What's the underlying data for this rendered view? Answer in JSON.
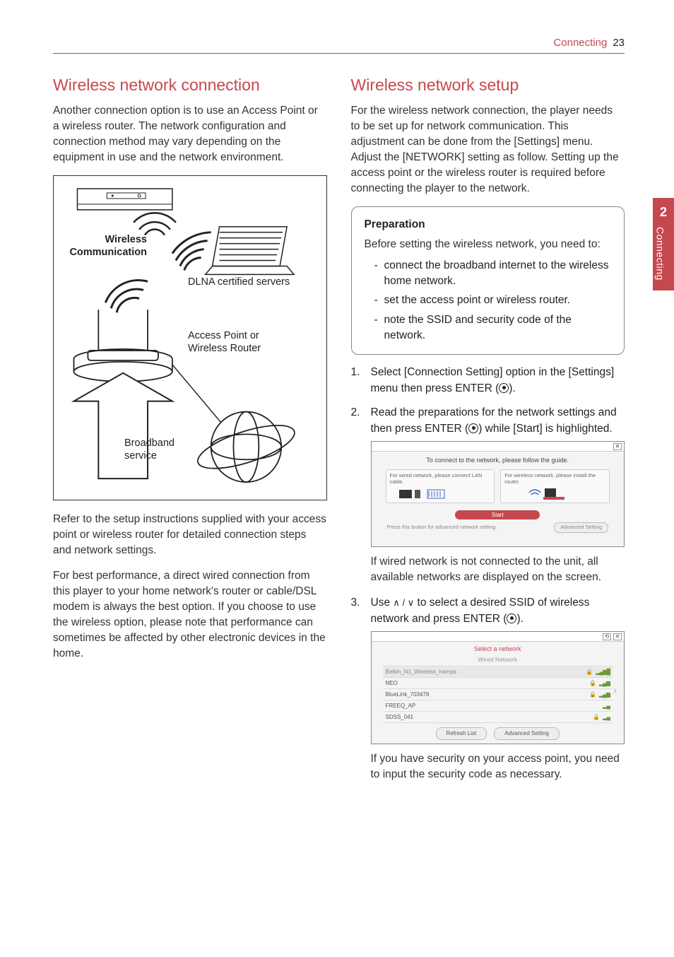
{
  "header": {
    "section": "Connecting",
    "page": "23"
  },
  "sidetab": {
    "number": "2",
    "label": "Connecting"
  },
  "left": {
    "heading": "Wireless network connection",
    "intro": "Another connection option is to use an Access Point or a wireless router. The network configuration and connection method may vary depending on the equipment in use and the network environment.",
    "diagram": {
      "wireless_comm_1": "Wireless",
      "wireless_comm_2": "Communication",
      "dlna": "DLNA certified servers",
      "ap_1": "Access Point or",
      "ap_2": "Wireless Router",
      "bb_1": "Broadband",
      "bb_2": "service"
    },
    "p2": "Refer to the setup instructions supplied with your access point or wireless router for detailed connection steps and network settings.",
    "p3": "For best performance, a direct wired connection from this player to your home network's router or cable/DSL modem is always the best option. If you choose to use the wireless option, please note that performance can sometimes be affected by other electronic devices in the home."
  },
  "right": {
    "heading": "Wireless network setup",
    "intro": "For the wireless network connection, the player needs to be set up for network communication. This adjustment can be done from the [Settings] menu. Adjust the [NETWORK] setting as follow. Setting up the access point or the wireless router is required before connecting the player to the network.",
    "prep": {
      "title": "Preparation",
      "lead": "Before setting the wireless network, you need to:",
      "items": [
        "connect the broadband internet to the wireless home network.",
        "set the access point or wireless router.",
        "note the SSID and security code of the network."
      ]
    },
    "steps": {
      "s1_num": "1.",
      "s1": "Select [Connection Setting] option in the [Settings] menu then press ENTER (",
      "s1_end": ").",
      "s2_num": "2.",
      "s2": "Read the preparations for the network settings and then press ENTER (",
      "s2_end": ") while [Start] is highlighted.",
      "s2_after": "If wired network is not connected to the unit, all available networks are displayed on the screen.",
      "s3_num": "3.",
      "s3_a": "Use ",
      "s3_arrows": "∧ / ∨",
      "s3_b": " to select a desired SSID of wireless network and press ENTER (",
      "s3_end": ").",
      "s3_after": "If you have security on your access point, you need to input the security code as necessary."
    },
    "screenshot1": {
      "guide": "To connect to the network, please follow the guide.",
      "wired": "For wired network, please connect LAN cable.",
      "wireless": "For wireless network, please install the router.",
      "start": "Start",
      "adv_text": "Press this button for advanced network setting.",
      "adv_btn": "Advanced Setting"
    },
    "screenshot2": {
      "title": "Select a network",
      "wired": "Wired Network",
      "networks": [
        {
          "ssid": "Belkin_N1_Wireless_hampa",
          "lock": true,
          "strength": 4
        },
        {
          "ssid": "NEO",
          "lock": true,
          "strength": 3
        },
        {
          "ssid": "BlueLink_703478",
          "lock": true,
          "strength": 3
        },
        {
          "ssid": "FREEQ_AP",
          "lock": false,
          "strength": 2
        },
        {
          "ssid": "SDSS_041",
          "lock": true,
          "strength": 2
        }
      ],
      "refresh": "Refresh List",
      "advanced": "Advanced Setting"
    }
  }
}
